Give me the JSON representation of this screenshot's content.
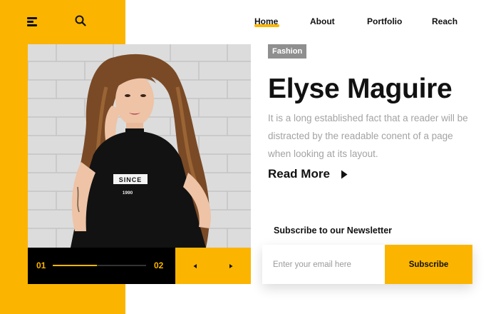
{
  "header": {
    "menu_icon": "hamburger-icon",
    "search_icon": "search-icon",
    "nav": [
      {
        "label": "Home",
        "active": true
      },
      {
        "label": "About",
        "active": false
      },
      {
        "label": "Portfolio",
        "active": false
      },
      {
        "label": "Reach",
        "active": false
      }
    ]
  },
  "slider": {
    "current": "01",
    "next": "02",
    "progress": 0.47,
    "prev_icon": "triangle-left-icon",
    "next_icon": "triangle-right-icon"
  },
  "article": {
    "tag": "Fashion",
    "title": "Elyse Maguire",
    "description": "It is a long established fact that a reader will be distracted by the readable conent of a page when looking at its layout.",
    "read_more": "Read More",
    "read_more_icon": "triangle-right-icon"
  },
  "newsletter": {
    "title": "Subscribe to our Newsletter",
    "placeholder": "Enter your email here",
    "button": "Subscribe"
  },
  "colors": {
    "accent": "#fbb500",
    "dark": "#000000",
    "tag_bg": "#8f8f8f",
    "muted_text": "#a3a3a3"
  }
}
